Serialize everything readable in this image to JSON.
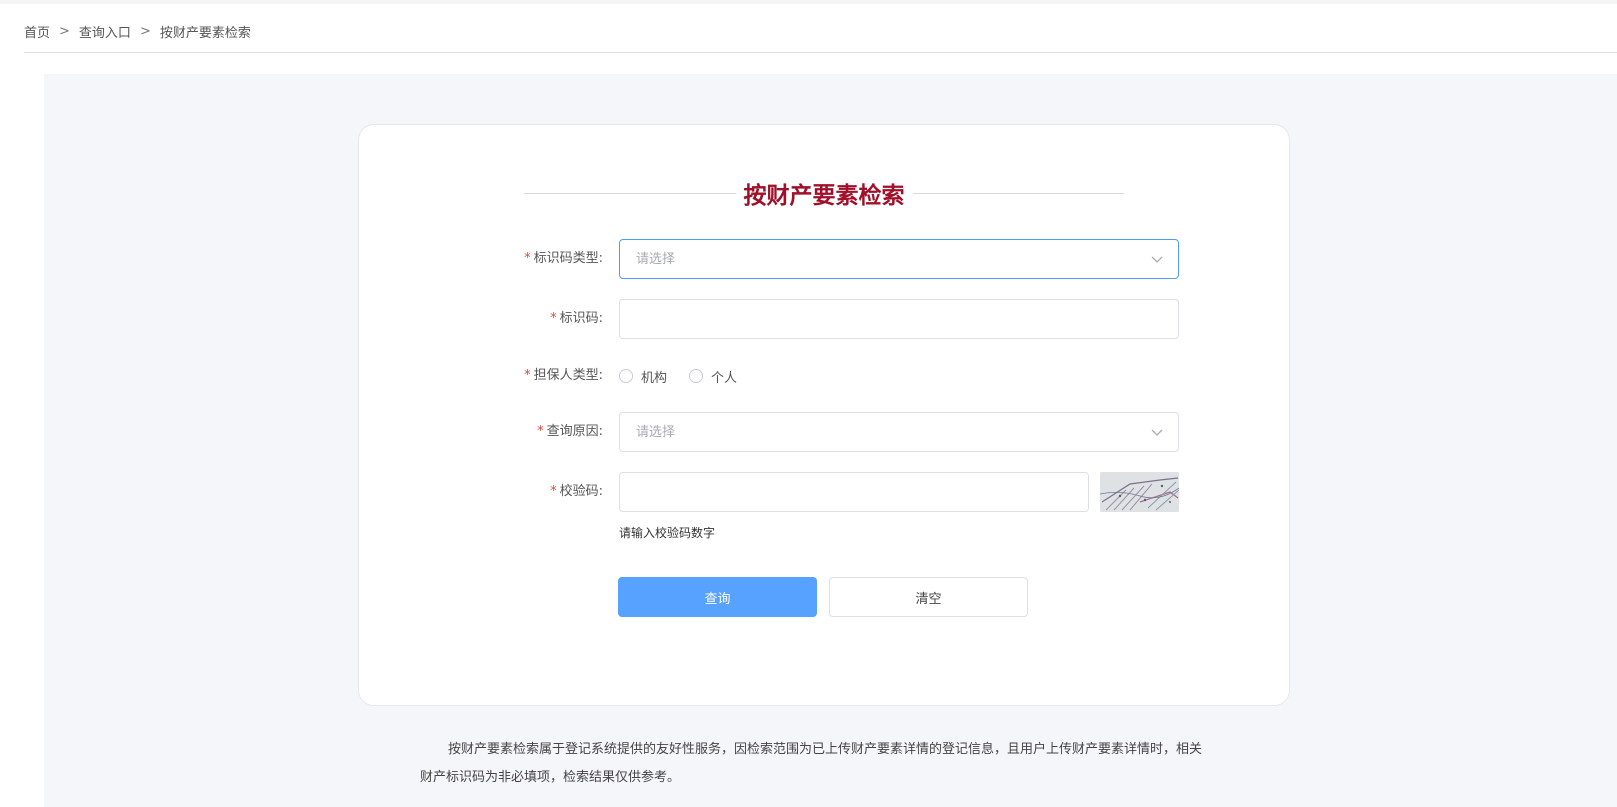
{
  "breadcrumb": {
    "items": [
      "首页",
      "查询入口",
      "按财产要素检索"
    ],
    "separator": ">"
  },
  "form": {
    "title": "按财产要素检索",
    "required_mark": "*",
    "id_type": {
      "label": "标识码类型:",
      "placeholder": "请选择"
    },
    "id_code": {
      "label": "标识码:",
      "value": ""
    },
    "guarantor_type": {
      "label": "担保人类型:",
      "options": [
        "机构",
        "个人"
      ]
    },
    "query_reason": {
      "label": "查询原因:",
      "placeholder": "请选择"
    },
    "captcha": {
      "label": "校验码:",
      "value": "",
      "hint": "请输入校验码数字"
    },
    "buttons": {
      "query": "查询",
      "clear": "清空"
    }
  },
  "note": "按财产要素检索属于登记系统提供的友好性服务，因检索范围为已上传财产要素详情的登记信息，且用户上传财产要素详情时，相关财产标识码为非必填项，检索结果仅供参考。",
  "colors": {
    "title": "#a0102a",
    "primary": "#57a2ff",
    "required": "#e0453a",
    "focus_border": "#4d9cff"
  }
}
